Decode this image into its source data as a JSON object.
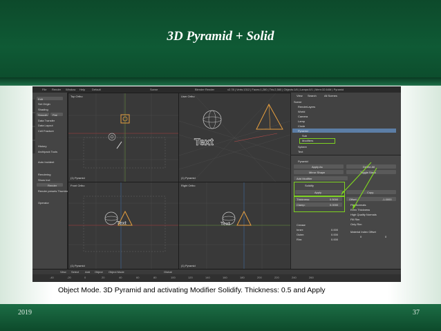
{
  "slide": {
    "title": "3D Pyramid + Solid",
    "caption": "Object Mode. 3D Pyramid and activating Modifier Solidify. Thickness: 0.5 and Apply",
    "footer_left": "2019",
    "footer_right": "37"
  },
  "blender": {
    "menu": [
      "File",
      "Render",
      "Window",
      "Help",
      "Default",
      "Scene",
      "Blender Render"
    ],
    "status": "v2.78 | Verts:1312 | Faces:1,280 | Tris:2,560 | Objects:1/6 | Lamps:0/1 | Mem:32.64M | Pyramid",
    "toolshelf": [
      "Edit",
      "Set Origin",
      "Shading",
      "Smooth",
      "Flat",
      "Data Transfer",
      "Data Layout",
      "Cell Fracture",
      "History",
      "Archipack Tools",
      "Auto Incident",
      "Rendering",
      "Show Incl",
      "Render",
      "Render presets Thumbn..",
      "Operator"
    ],
    "viewports": {
      "top_left": {
        "label": "Top Ortho",
        "object": "(1) Pyramid"
      },
      "top_right": {
        "label": "User Ortho",
        "object": "(1) Pyramid",
        "text_object": "Text"
      },
      "bottom_left": {
        "label": "Front Ortho",
        "object": "(1) Pyramid",
        "text_object": "Text"
      },
      "bottom_right": {
        "label": "Right Ortho",
        "object": "(1) Pyramid",
        "text_object": "Text"
      }
    },
    "outliner": {
      "header": [
        "View",
        "Search",
        "All Scenes"
      ],
      "items": [
        "Scene",
        "RenderLayers",
        "World",
        "Camera",
        "Lamp",
        "Circle",
        "Pyramid",
        "Sub",
        "Modifiers",
        "Sphere",
        "Text"
      ]
    },
    "properties": {
      "object_name": "Pyramid",
      "add_modifier": "Add Modifier",
      "modifier": "Solidify",
      "buttons": [
        "Apply",
        "Copy",
        "Apply As",
        "Delete All",
        "Mirror Shape",
        "Toggle Stack"
      ],
      "thickness_label": "Thickness:",
      "thickness_value": "0.5000",
      "offset_label": "Offset:",
      "offset_value": "-1.0000",
      "clamp_label": "Clamp:",
      "clamp_value": "0.0000",
      "checks": [
        "Flip Normals",
        "Even Thickness",
        "High Quality Normals",
        "Fill Rim",
        "Only Rim"
      ],
      "crease": [
        "Crease",
        "Inner:",
        "Outer:",
        "Rim:"
      ],
      "crease_values": [
        "0.000",
        "0.000",
        "0.000"
      ],
      "material_offset": "Material Index Offset",
      "mat_values": [
        "0",
        "0"
      ]
    },
    "timeline": {
      "menu": [
        "View",
        "Select",
        "Add",
        "Object",
        "Object Mode",
        "Global"
      ],
      "frames": [
        "-40",
        "-20",
        "0",
        "20",
        "40",
        "60",
        "80",
        "100",
        "120",
        "140",
        "160",
        "180",
        "200",
        "220",
        "240",
        "260"
      ]
    },
    "colors": {
      "highlight": "#7ed321",
      "selection": "#5c7ea6",
      "object_orange": "#e8a040"
    }
  }
}
